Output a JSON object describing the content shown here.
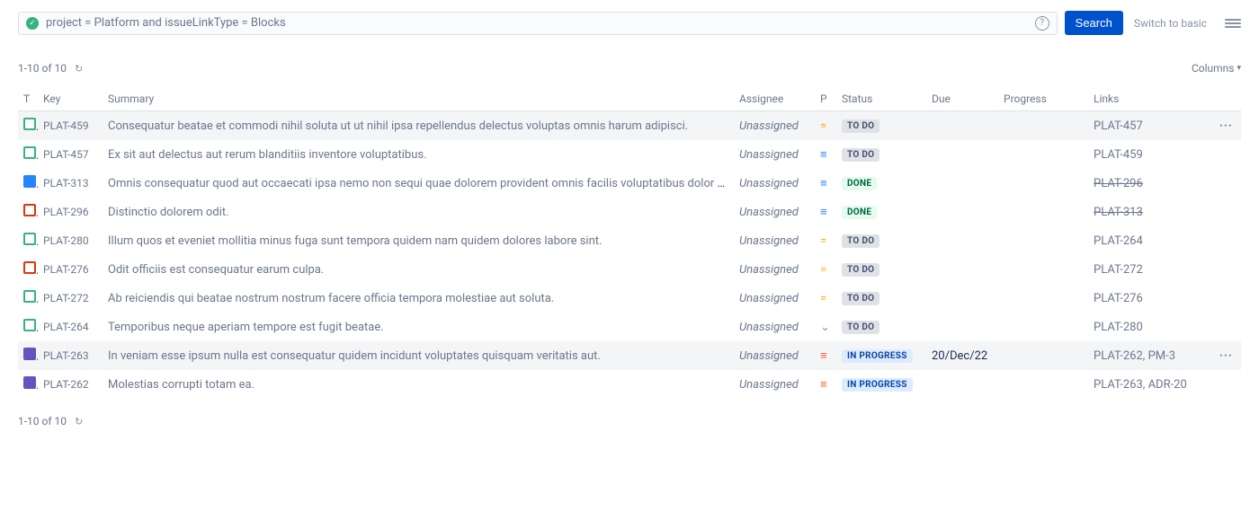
{
  "search": {
    "jql": "project = Platform and issueLinkType = Blocks",
    "search_label": "Search",
    "switch_label": "Switch to basic",
    "help_glyph": "?"
  },
  "results_count": "1-10 of 10",
  "columns_label": "Columns",
  "headers": {
    "type": "T",
    "key": "Key",
    "summary": "Summary",
    "assignee": "Assignee",
    "priority": "P",
    "status": "Status",
    "due": "Due",
    "progress": "Progress",
    "links": "Links"
  },
  "priorities": {
    "medium": "=",
    "low": "≡",
    "high": "≡",
    "lowest": "⌄"
  },
  "rows": [
    {
      "type": "story",
      "key": "PLAT-459",
      "summary": "Consequatur beatae et commodi nihil soluta ut ut nihil ipsa repellendus delectus voluptas omnis harum adipisci.",
      "assignee": "Unassigned",
      "priority": "medium",
      "status": "TO DO",
      "status_class": "st-todo",
      "due": "",
      "links": "PLAT-457",
      "links_done": false,
      "hovered": true
    },
    {
      "type": "story",
      "key": "PLAT-457",
      "summary": "Ex sit aut delectus aut rerum blanditiis inventore voluptatibus.",
      "assignee": "Unassigned",
      "priority": "low",
      "status": "TO DO",
      "status_class": "st-todo",
      "due": "",
      "links": "PLAT-459",
      "links_done": false
    },
    {
      "type": "task",
      "key": "PLAT-313",
      "summary": "Omnis consequatur quod aut occaecati ipsa nemo non sequi quae dolorem provident omnis facilis voluptatibus dolor sunt.",
      "assignee": "Unassigned",
      "priority": "low",
      "status": "DONE",
      "status_class": "st-done",
      "due": "",
      "links": "PLAT-296",
      "links_done": true
    },
    {
      "type": "bug",
      "key": "PLAT-296",
      "summary": "Distinctio dolorem odit.",
      "assignee": "Unassigned",
      "priority": "low",
      "status": "DONE",
      "status_class": "st-done",
      "due": "",
      "links": "PLAT-313",
      "links_done": true
    },
    {
      "type": "story",
      "key": "PLAT-280",
      "summary": "Illum quos et eveniet mollitia minus fuga sunt tempora quidem nam quidem dolores labore sint.",
      "assignee": "Unassigned",
      "priority": "medium",
      "status": "TO DO",
      "status_class": "st-todo",
      "due": "",
      "links": "PLAT-264",
      "links_done": false
    },
    {
      "type": "bug",
      "key": "PLAT-276",
      "summary": "Odit officiis est consequatur earum culpa.",
      "assignee": "Unassigned",
      "priority": "medium",
      "status": "TO DO",
      "status_class": "st-todo",
      "due": "",
      "links": "PLAT-272",
      "links_done": false
    },
    {
      "type": "story",
      "key": "PLAT-272",
      "summary": "Ab reiciendis qui beatae nostrum nostrum facere officia tempora molestiae aut soluta.",
      "assignee": "Unassigned",
      "priority": "medium",
      "status": "TO DO",
      "status_class": "st-todo",
      "due": "",
      "links": "PLAT-276",
      "links_done": false
    },
    {
      "type": "story",
      "key": "PLAT-264",
      "summary": "Temporibus neque aperiam tempore est fugit beatae.",
      "assignee": "Unassigned",
      "priority": "lowest",
      "status": "TO DO",
      "status_class": "st-todo",
      "due": "",
      "links": "PLAT-280",
      "links_done": false
    },
    {
      "type": "epic",
      "key": "PLAT-263",
      "summary": "In veniam esse ipsum nulla est consequatur quidem incidunt voluptates quisquam veritatis aut.",
      "assignee": "Unassigned",
      "priority": "high",
      "status": "IN PROGRESS",
      "status_class": "st-inprogress",
      "due": "20/Dec/22",
      "links": "PLAT-262, PM-3",
      "links_done": false,
      "hovered": true
    },
    {
      "type": "epic",
      "key": "PLAT-262",
      "summary": "Molestias corrupti totam ea.",
      "assignee": "Unassigned",
      "priority": "high",
      "status": "IN PROGRESS",
      "status_class": "st-inprogress",
      "due": "",
      "links": "PLAT-263, ADR-20",
      "links_done": false
    }
  ],
  "row_actions_glyph": "···",
  "refresh_glyph": "↻"
}
